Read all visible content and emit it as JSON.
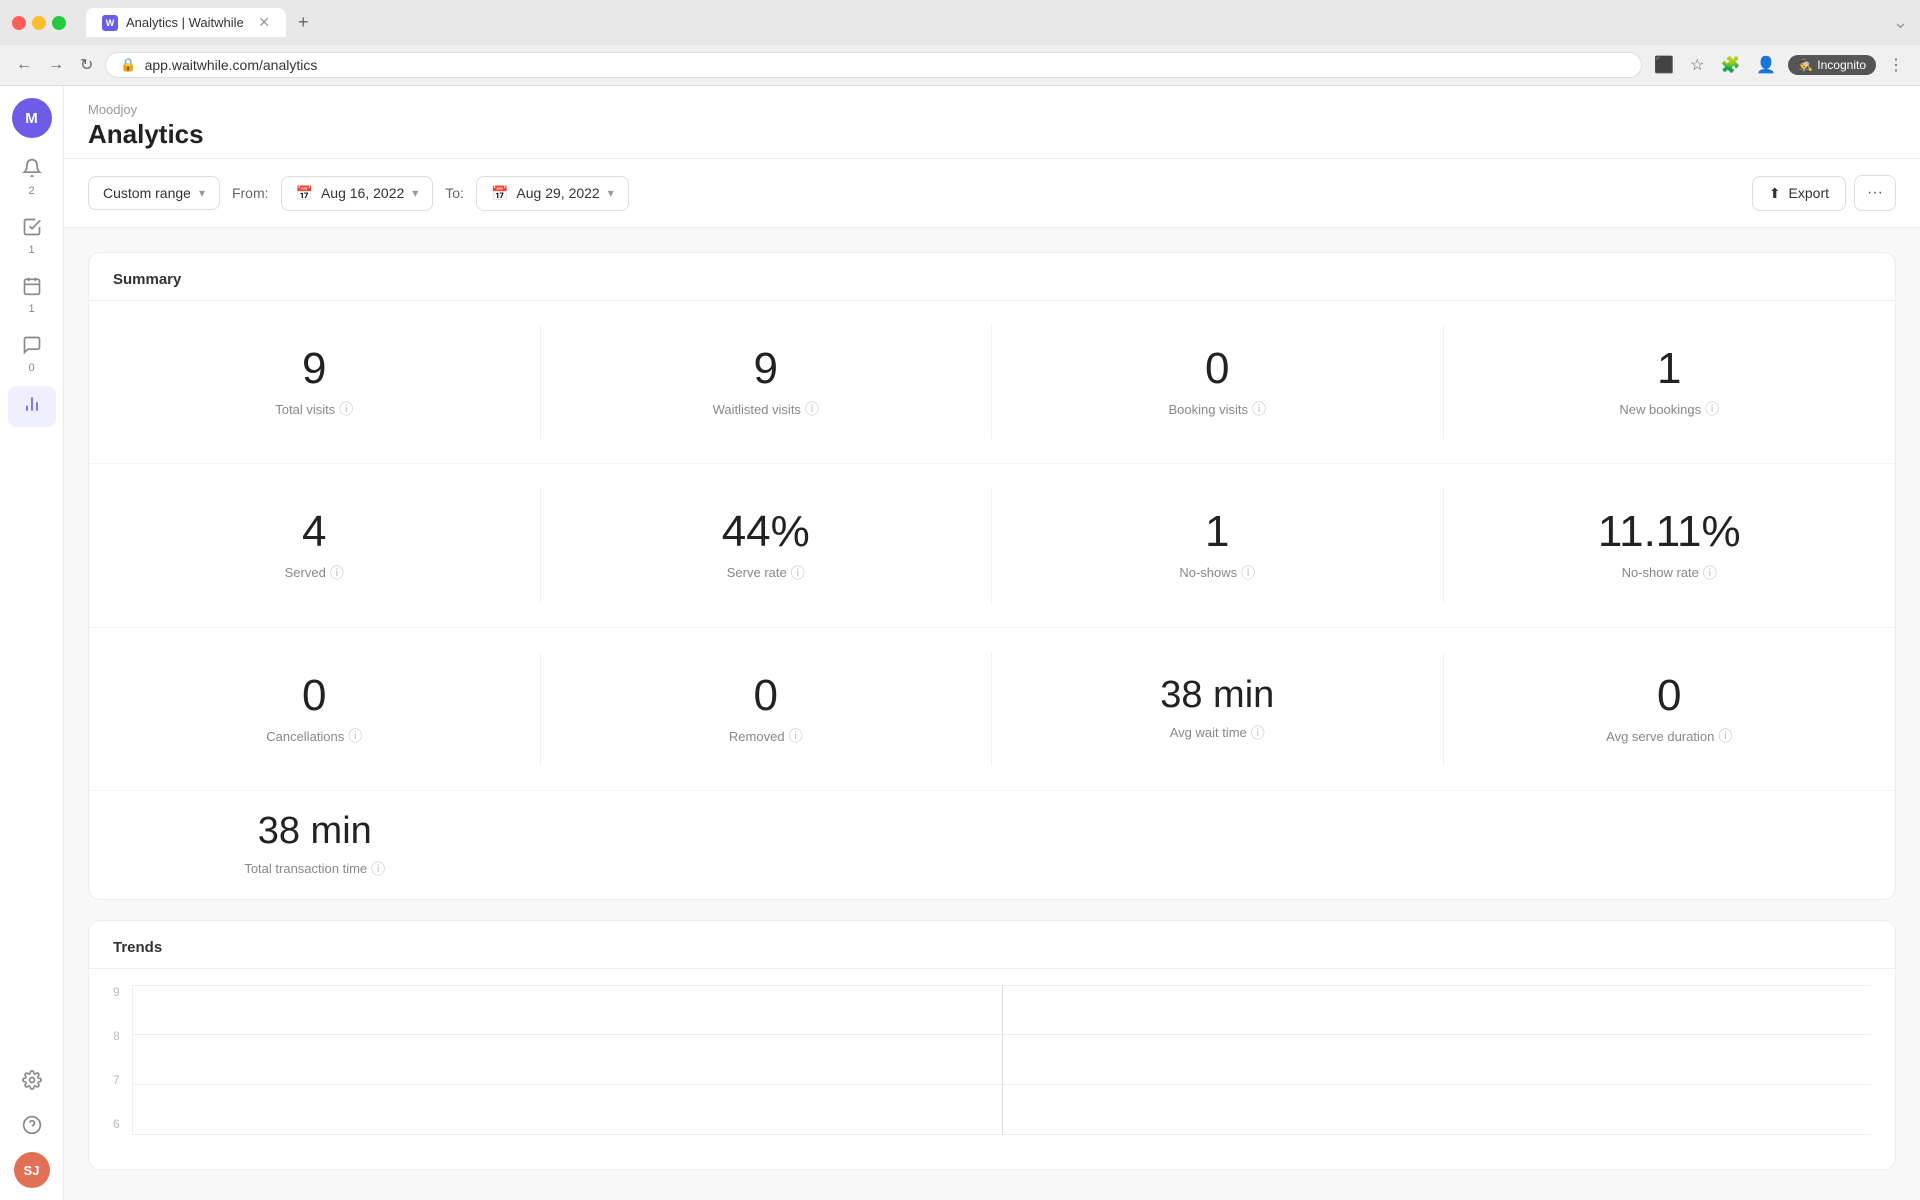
{
  "browser": {
    "tab_title": "Analytics | Waitwhile",
    "tab_icon": "W",
    "url": "app.waitwhile.com/analytics",
    "incognito_label": "Incognito"
  },
  "sidebar": {
    "org_avatar": "M",
    "org_name": "Moodjoy",
    "items": [
      {
        "id": "notifications",
        "icon": "🔔",
        "badge": "2",
        "active": false
      },
      {
        "id": "tasks",
        "icon": "✓",
        "badge": "1",
        "active": false
      },
      {
        "id": "calendar",
        "icon": "📅",
        "badge": "1",
        "active": false
      },
      {
        "id": "messages",
        "icon": "💬",
        "badge": "0",
        "active": false
      },
      {
        "id": "analytics",
        "icon": "📊",
        "badge": "",
        "active": true
      },
      {
        "id": "settings",
        "icon": "⚙",
        "badge": "",
        "active": false
      }
    ],
    "user_avatar": "SJ"
  },
  "page": {
    "breadcrumb": "Moodjoy",
    "title": "Analytics"
  },
  "toolbar": {
    "range_label": "Custom range",
    "from_label": "From:",
    "from_date": "Aug 16, 2022",
    "to_label": "To:",
    "to_date": "Aug 29, 2022",
    "export_label": "Export"
  },
  "summary": {
    "title": "Summary",
    "metrics": [
      {
        "value": "9",
        "label": "Total visits"
      },
      {
        "value": "9",
        "label": "Waitlisted visits"
      },
      {
        "value": "0",
        "label": "Booking visits"
      },
      {
        "value": "1",
        "label": "New bookings"
      },
      {
        "value": "4",
        "label": "Served"
      },
      {
        "value": "44%",
        "label": "Serve rate"
      },
      {
        "value": "1",
        "label": "No-shows"
      },
      {
        "value": "11.11%",
        "label": "No-show rate"
      },
      {
        "value": "0",
        "label": "Cancellations"
      },
      {
        "value": "0",
        "label": "Removed"
      },
      {
        "value": "38 min",
        "label": "Avg wait time"
      },
      {
        "value": "0",
        "label": "Avg serve duration"
      },
      {
        "value": "38 min",
        "label": "Total transaction time"
      }
    ]
  },
  "trends": {
    "title": "Trends",
    "y_labels": [
      "9",
      "8",
      "7",
      "6"
    ]
  }
}
